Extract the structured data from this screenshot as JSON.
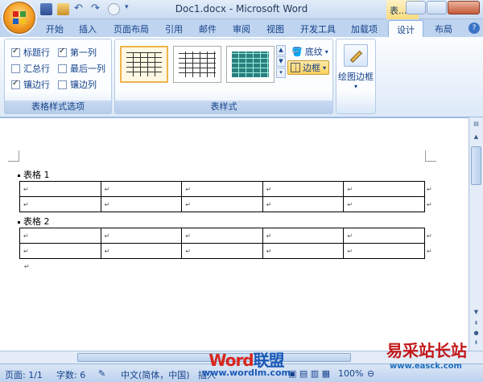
{
  "titlebar": {
    "document_title": "Doc1.docx - Microsoft Word",
    "context_tab_title": "表..."
  },
  "tabs": [
    "开始",
    "插入",
    "页面布局",
    "引用",
    "邮件",
    "审阅",
    "视图",
    "开发工具",
    "加载项",
    "设计",
    "布局"
  ],
  "active_tab": "设计",
  "ribbon": {
    "options_group": {
      "label": "表格样式选项",
      "items": [
        {
          "label": "标题行",
          "checked": true
        },
        {
          "label": "第一列",
          "checked": true
        },
        {
          "label": "汇总行",
          "checked": false
        },
        {
          "label": "最后一列",
          "checked": false
        },
        {
          "label": "镶边行",
          "checked": true
        },
        {
          "label": "镶边列",
          "checked": false
        }
      ]
    },
    "styles_group": {
      "label": "表样式",
      "shading_label": "底纹",
      "borders_label": "边框"
    },
    "draw_group": {
      "draw_border_label": "绘图边框"
    }
  },
  "document": {
    "table1_caption": "表格 1",
    "table2_caption": "表格 2",
    "table1_rows": 2,
    "table2_rows": 2,
    "columns": 5
  },
  "status": {
    "page": "页面: 1/1",
    "words": "字数: 6",
    "language": "中文(简体，中国)",
    "mode": "插入",
    "zoom": "100%"
  },
  "watermarks": {
    "word_a": "Word",
    "word_b": "联盟",
    "url": "www.wordlm.com",
    "right_title": "易采站长站",
    "right_url": "www.easck.com"
  },
  "colors": {
    "accent": "#15428b",
    "ribbon_bg": "#dde9f8",
    "active_tab": "#fbfcfe",
    "hot_button": "#ffd25e"
  }
}
